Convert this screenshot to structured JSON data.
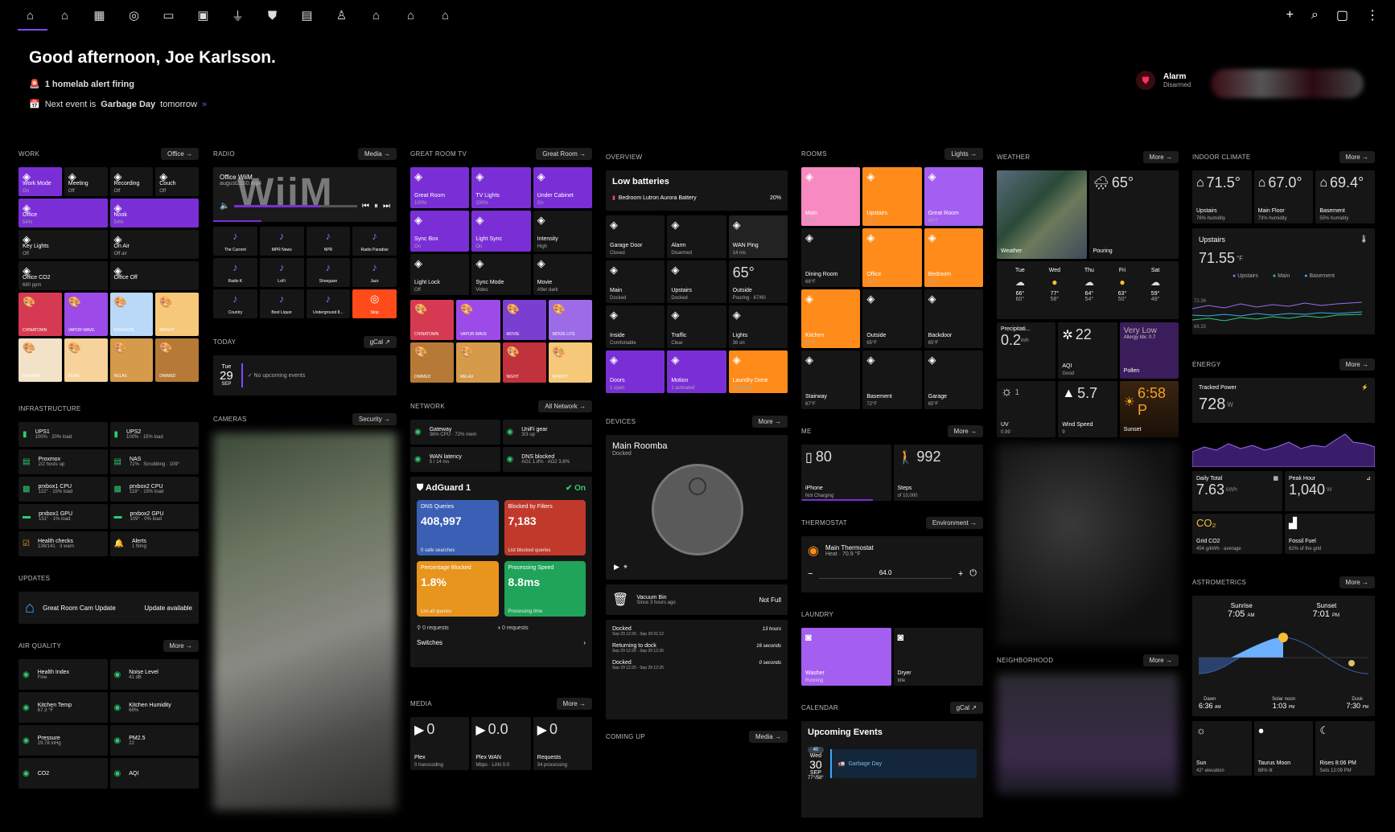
{
  "nav": {
    "icons": [
      "home-icon",
      "house-icon",
      "building-icon",
      "lightbulb-icon",
      "tv-icon",
      "monitor-icon",
      "plug-icon",
      "shield-icon",
      "folder-icon",
      "person-icon",
      "house-up-icon",
      "house-alt-icon",
      "house-network-icon"
    ],
    "right": [
      "plus-icon",
      "search-icon",
      "chat-icon",
      "more-icon"
    ]
  },
  "greeting": {
    "title": "Good afternoon, Joe Karlsson.",
    "alert": "1 homelab alert firing",
    "event_pre": "Next event is",
    "event_name": "Garbage Day",
    "event_post": "tomorrow"
  },
  "alarm": {
    "title": "Alarm",
    "state": "Disarmed"
  },
  "work": {
    "title": "WORK",
    "chip": "Office",
    "tiles": [
      {
        "n": "Work Mode",
        "s": "On",
        "c": "purple"
      },
      {
        "n": "Meeting",
        "s": "Off",
        "c": ""
      },
      {
        "n": "Recording",
        "s": "Off",
        "c": ""
      },
      {
        "n": "Couch",
        "s": "Off",
        "c": ""
      },
      {
        "n": "Office",
        "s": "54%",
        "c": "purple",
        "w": 2
      },
      {
        "n": "Nook",
        "s": "54%",
        "c": "purple",
        "w": 2
      },
      {
        "n": "Key Lights",
        "s": "Off",
        "c": "",
        "w": 2
      },
      {
        "n": "On Air",
        "s": "Off air",
        "c": "",
        "w": 2
      },
      {
        "n": "Office CO2",
        "s": "680 ppm",
        "c": "",
        "w": 2
      },
      {
        "n": "Office Off",
        "s": "",
        "c": "",
        "w": 2
      }
    ],
    "scenes": [
      {
        "n": "CHINATOWN",
        "c": "#d63a52"
      },
      {
        "n": "VAPOR WAVE",
        "c": "#9d4be8"
      },
      {
        "n": "ENERGIZE",
        "c": "#bad8f8"
      },
      {
        "n": "BRIGHT",
        "c": "#f6c87a"
      },
      {
        "n": "NATURAL",
        "c": "#f2e3c8"
      },
      {
        "n": "READ",
        "c": "#f6d39a"
      },
      {
        "n": "RELAX",
        "c": "#d59a4a"
      },
      {
        "n": "DIMMED",
        "c": "#b67a36"
      }
    ]
  },
  "infra": {
    "title": "INFRASTRUCTURE",
    "items": [
      {
        "n": "UPS1",
        "s": "100% · 20% load",
        "i": "battery-icon"
      },
      {
        "n": "UPS2",
        "s": "100% · 15% load",
        "i": "battery-icon"
      },
      {
        "n": "Proxmox",
        "s": "2/2 hosts up",
        "i": "server-icon"
      },
      {
        "n": "NAS",
        "s": "72% · Scrubbing · 109°",
        "i": "server-icon"
      },
      {
        "n": "prxbox1 CPU",
        "s": "122° · 15% load",
        "i": "cpu-icon"
      },
      {
        "n": "prxbox2 CPU",
        "s": "118° · 15% load",
        "i": "cpu-icon"
      },
      {
        "n": "prxbox1 GPU",
        "s": "151° · 1% load",
        "i": "gpu-icon"
      },
      {
        "n": "prxbox2 GPU",
        "s": "109° · 0% load",
        "i": "gpu-icon"
      },
      {
        "n": "Health checks",
        "s": "138/141 · 3 warn",
        "i": "check-icon"
      },
      {
        "n": "Alerts",
        "s": "1 firing",
        "i": "bell-icon"
      }
    ]
  },
  "updates": {
    "title": "UPDATES",
    "name": "Great Room Cam Update",
    "status": "Update available"
  },
  "air": {
    "title": "AIR QUALITY",
    "chip": "More",
    "items": [
      {
        "n": "Health Index",
        "s": "Fine"
      },
      {
        "n": "Noise Level",
        "s": "41 dB"
      },
      {
        "n": "Kitchen Temp",
        "s": "67.3 °F"
      },
      {
        "n": "Kitchen Humidity",
        "s": "69%"
      },
      {
        "n": "Pressure",
        "s": "29.78 inHg"
      },
      {
        "n": "PM2.5",
        "s": "22"
      },
      {
        "n": "CO2",
        "s": ""
      },
      {
        "n": "AQI",
        "s": ""
      }
    ]
  },
  "radio": {
    "title": "RADIO",
    "chip": "Media",
    "player_title": "Office WiiM",
    "player_sub": "august2160.mp4",
    "brand": "WiiM",
    "stations": [
      "The Current",
      "MPR News",
      "NPR",
      "Radio Paradise",
      "Radio K",
      "LoFi",
      "Shoegaze",
      "Jazz",
      "Country",
      "Boot Liquor",
      "Underground 8...",
      "Stop"
    ]
  },
  "today": {
    "title": "TODAY",
    "chip": "gCal",
    "dow": "Tue",
    "day": "29",
    "mon": "SEP",
    "text": "No upcoming events"
  },
  "cameras": {
    "title": "CAMERAS",
    "chip": "Security"
  },
  "tv": {
    "title": "GREAT ROOM TV",
    "chip": "Great Room",
    "tiles": [
      {
        "n": "Great Room",
        "s": "100%",
        "c": "purple"
      },
      {
        "n": "TV Lights",
        "s": "100%",
        "c": "purple"
      },
      {
        "n": "Under Cabinet",
        "s": "On",
        "c": "purple"
      },
      {
        "n": "Sync Box",
        "s": "On",
        "c": "purple"
      },
      {
        "n": "Light Sync",
        "s": "On",
        "c": "purple"
      },
      {
        "n": "Intensity",
        "s": "High",
        "c": ""
      },
      {
        "n": "Light Lock",
        "s": "Off",
        "c": ""
      },
      {
        "n": "Sync Mode",
        "s": "Video",
        "c": ""
      },
      {
        "n": "Movie",
        "s": "After dark",
        "c": ""
      }
    ],
    "scenes": [
      {
        "n": "CHINATOWN",
        "c": "#d63a52"
      },
      {
        "n": "VAPOR WAVE",
        "c": "#9d4be8"
      },
      {
        "n": "MOVIE",
        "c": "#7a3fd0"
      },
      {
        "n": "MOVIE LITE",
        "c": "#9d6be8"
      },
      {
        "n": "DIMMED",
        "c": "#b67a36"
      },
      {
        "n": "RELAX",
        "c": "#d59a4a"
      },
      {
        "n": "NIGHT",
        "c": "#c1323c"
      },
      {
        "n": "BRIGHT",
        "c": "#f6c87a"
      }
    ]
  },
  "network": {
    "title": "NETWORK",
    "chip": "All Network",
    "items": [
      {
        "n": "Gateway",
        "s": "36% CPU · 72% mem"
      },
      {
        "n": "UniFi gear",
        "s": "3/3 up"
      },
      {
        "n": "WAN latency",
        "s": "5 / 14 ms"
      },
      {
        "n": "DNS blocked",
        "s": "AG1 1.8% · AG2 3.8%"
      }
    ]
  },
  "adguard": {
    "title": "AdGuard 1",
    "state": "On",
    "cards": [
      {
        "n": "DNS Queries",
        "v": "408,997",
        "s": "0 safe searches",
        "c": "#3a5fb4"
      },
      {
        "n": "Blocked by Filters",
        "v": "7,183",
        "s": "List blocked queries",
        "c": "#c0392b"
      },
      {
        "n": "Percentage Blocked",
        "v": "1.8%",
        "s": "List all queries",
        "c": "#e8951d"
      },
      {
        "n": "Processing Speed",
        "v": "8.8ms",
        "s": "Processing time",
        "c": "#1fa45a"
      }
    ],
    "req1": "0 requests",
    "req2": "0 requests",
    "switches": "Switches"
  },
  "media": {
    "title": "MEDIA",
    "chip": "More",
    "items": [
      {
        "n": "Plex",
        "s": "0 transcoding",
        "v": "0"
      },
      {
        "n": "Plex WAN",
        "s": "Mbps · LAN 0.0",
        "v": "0.0"
      },
      {
        "n": "Requests",
        "s": "34 processing",
        "v": "0"
      }
    ]
  },
  "overview": {
    "title": "OVERVIEW",
    "lowbat": "Low batteries",
    "bat_name": "Bedroom Lutron Aurora Battery",
    "bat_pct": "20%",
    "tiles": [
      {
        "n": "Garage Door",
        "s": "Closed"
      },
      {
        "n": "Alarm",
        "s": "Disarmed"
      },
      {
        "n": "WAN Ping",
        "s": "14 ms"
      },
      {
        "n": "Main",
        "s": "Docked"
      },
      {
        "n": "Upstairs",
        "s": "Docked"
      },
      {
        "n": "Outside",
        "s": "Pouring · 67/60",
        "v": "65°"
      },
      {
        "n": "Inside",
        "s": "Comfortable"
      },
      {
        "n": "Traffic",
        "s": "Clear"
      },
      {
        "n": "Lights",
        "s": "36 on"
      },
      {
        "n": "Doors",
        "s": "1 open"
      },
      {
        "n": "Motion",
        "s": "1 activated"
      },
      {
        "n": "Laundry Done",
        "s": "Nightlight"
      }
    ]
  },
  "devices": {
    "title": "DEVICES",
    "chip": "More",
    "name": "Main Roomba",
    "state": "Docked",
    "bin": "Vacuum Bin",
    "bin_sub": "Since 3 hours ago",
    "bin_state": "Not Full",
    "log": [
      {
        "n": "Docked",
        "t": "Sep 29 12:26 - Sep 29 01:12",
        "d": "13 hours"
      },
      {
        "n": "Returning to dock",
        "t": "Sep 29 12:26 - Sep 29 12:26",
        "d": "16 seconds"
      },
      {
        "n": "Docked",
        "t": "Sep 29 12:25 - Sep 29 12:25",
        "d": "0 seconds"
      }
    ]
  },
  "comingup": {
    "title": "COMING UP",
    "chip": "Media"
  },
  "rooms": {
    "title": "ROOMS",
    "chip": "Lights",
    "tiles": [
      {
        "n": "Main",
        "s": "65°F",
        "c": "pink"
      },
      {
        "n": "Upstairs",
        "s": "71°F",
        "c": "orange"
      },
      {
        "n": "Great Room",
        "s": "68°F",
        "c": "lpurple"
      },
      {
        "n": "Dining Room",
        "s": "68°F",
        "c": ""
      },
      {
        "n": "Office",
        "s": "73°F",
        "c": "orange"
      },
      {
        "n": "Bedroom",
        "s": "70°F",
        "c": "orange"
      },
      {
        "n": "Kitchen",
        "s": "67°F",
        "c": "orange"
      },
      {
        "n": "Outside",
        "s": "65°F",
        "c": ""
      },
      {
        "n": "Backdoor",
        "s": "65°F",
        "c": ""
      },
      {
        "n": "Stairway",
        "s": "67°F",
        "c": ""
      },
      {
        "n": "Basement",
        "s": "72°F",
        "c": ""
      },
      {
        "n": "Garage",
        "s": "65°F",
        "c": ""
      }
    ]
  },
  "me": {
    "title": "ME",
    "chip": "More",
    "phone": "iPhone",
    "phone_s": "Not Charging",
    "phone_v": "80",
    "steps": "Steps",
    "steps_s": "of 10,000",
    "steps_v": "992"
  },
  "thermostat": {
    "title": "THERMOSTAT",
    "chip": "Environment",
    "name": "Main Thermostat",
    "state": "Heat · 70.9 °F",
    "set": "64.0"
  },
  "laundry": {
    "title": "LAUNDRY",
    "washer": "Washer",
    "washer_s": "Running",
    "dryer": "Dryer",
    "dryer_s": "Idle"
  },
  "calendar": {
    "title": "CALENDAR",
    "chip": "gCal",
    "head": "Upcoming Events",
    "badge": "40",
    "dow": "Wed",
    "day": "30",
    "mon": "SEP",
    "temp": "77°/58°",
    "event": "Garbage Day"
  },
  "weather": {
    "title": "WEATHER",
    "chip": "More",
    "radar": "Weather",
    "now": "65°",
    "cond": "Pouring",
    "days": [
      {
        "d": "Tue",
        "h": "66°",
        "l": "60°"
      },
      {
        "d": "Wed",
        "h": "77°",
        "l": "58°"
      },
      {
        "d": "Thu",
        "h": "64°",
        "l": "54°"
      },
      {
        "d": "Fri",
        "h": "63°",
        "l": "50°"
      },
      {
        "d": "Sat",
        "h": "59°",
        "l": "48°"
      }
    ],
    "precip": "Precipitati...",
    "precip_v": "0.2",
    "precip_u": "in/h",
    "aqi": "AQI",
    "aqi_s": "Good",
    "aqi_v": "22",
    "pollen": "Pollen",
    "pollen_h": "Very Low",
    "pollen_s": "Allergy Idx: 0.7",
    "uv": "UV",
    "uv_s": "0.99",
    "uv_v": "1",
    "wind": "Wind Speed",
    "wind_s": "9",
    "wind_v": "5.7",
    "sunset": "Sunset",
    "sunset_v": "6:58 P"
  },
  "neighborhood": {
    "title": "NEIGHBORHOOD",
    "chip": "More"
  },
  "climate": {
    "title": "INDOOR CLIMATE",
    "chip": "More",
    "rooms": [
      {
        "n": "Upstairs",
        "s": "76% humidity",
        "v": "71.5°"
      },
      {
        "n": "Main Floor",
        "s": "73% humidity",
        "v": "67.0°"
      },
      {
        "n": "Basement",
        "s": "55% humidity",
        "v": "69.4°"
      }
    ],
    "graph_t": "Upstairs",
    "graph_v": "71.55",
    "graph_u": "°F",
    "legend": [
      "Upstairs",
      "Main",
      "Basement"
    ],
    "y1": "72.36",
    "y2": "66.33"
  },
  "energy": {
    "title": "ENERGY",
    "chip": "More",
    "tracked": "Tracked Power",
    "tracked_v": "728",
    "tracked_u": "W",
    "daily": "Daily Total",
    "daily_v": "7.63",
    "daily_u": "kWh",
    "peak": "Peak Hour",
    "peak_v": "1,040",
    "peak_u": "W",
    "grid": "Grid CO2",
    "grid_s": "454 g/kWh · average",
    "fossil": "Fossil Fuel",
    "fossil_s": "62% of the grid"
  },
  "astro": {
    "title": "ASTROMETRICS",
    "chip": "More",
    "sunrise": "Sunrise",
    "sunrise_v": "7:05",
    "sunset": "Sunset",
    "sunset_v": "7:01",
    "dawn": "Dawn",
    "dawn_v": "6:36",
    "noon": "Solar noon",
    "noon_v": "1:03",
    "dusk": "Dusk",
    "dusk_v": "7:30",
    "am": "AM",
    "pm": "PM",
    "sun": "Sun",
    "sun_s": "42° elevation",
    "moon": "Taurus Moon",
    "moon_s": "88% lit",
    "rises": "Rises 8:06 PM",
    "rises_s": "Sets 12:09 PM"
  }
}
